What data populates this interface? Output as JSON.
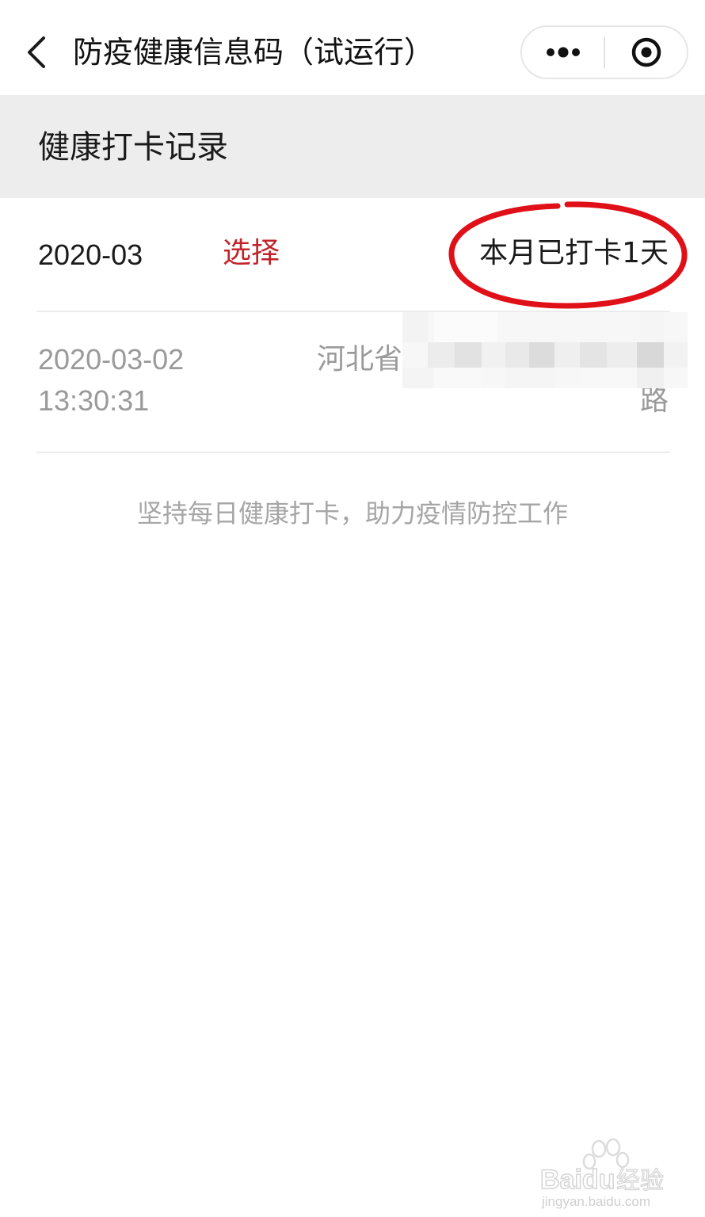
{
  "navbar": {
    "title": "防疫健康信息码（试运行）",
    "back_icon": "chevron-left-icon",
    "more_icon": "more-dots-icon",
    "close_icon": "target-circle-icon"
  },
  "section": {
    "title": "健康打卡记录"
  },
  "month_row": {
    "month": "2020-03",
    "select_label": "选择",
    "count_text": "本月已打卡1天",
    "highlight_color": "#e01018"
  },
  "records": [
    {
      "date": "2020-03-02",
      "time": "13:30:31",
      "location_start": "河北省",
      "location_end": "路"
    }
  ],
  "hint": "坚持每日健康打卡，助力疫情防控工作",
  "colors": {
    "accent_red": "#c0242a",
    "section_bg": "#ededed",
    "secondary_text": "#9a9a9a"
  },
  "watermark": {
    "brand": "Bai",
    "brand2": "du",
    "label": "经验",
    "url": "jingyan.baidu.com"
  }
}
